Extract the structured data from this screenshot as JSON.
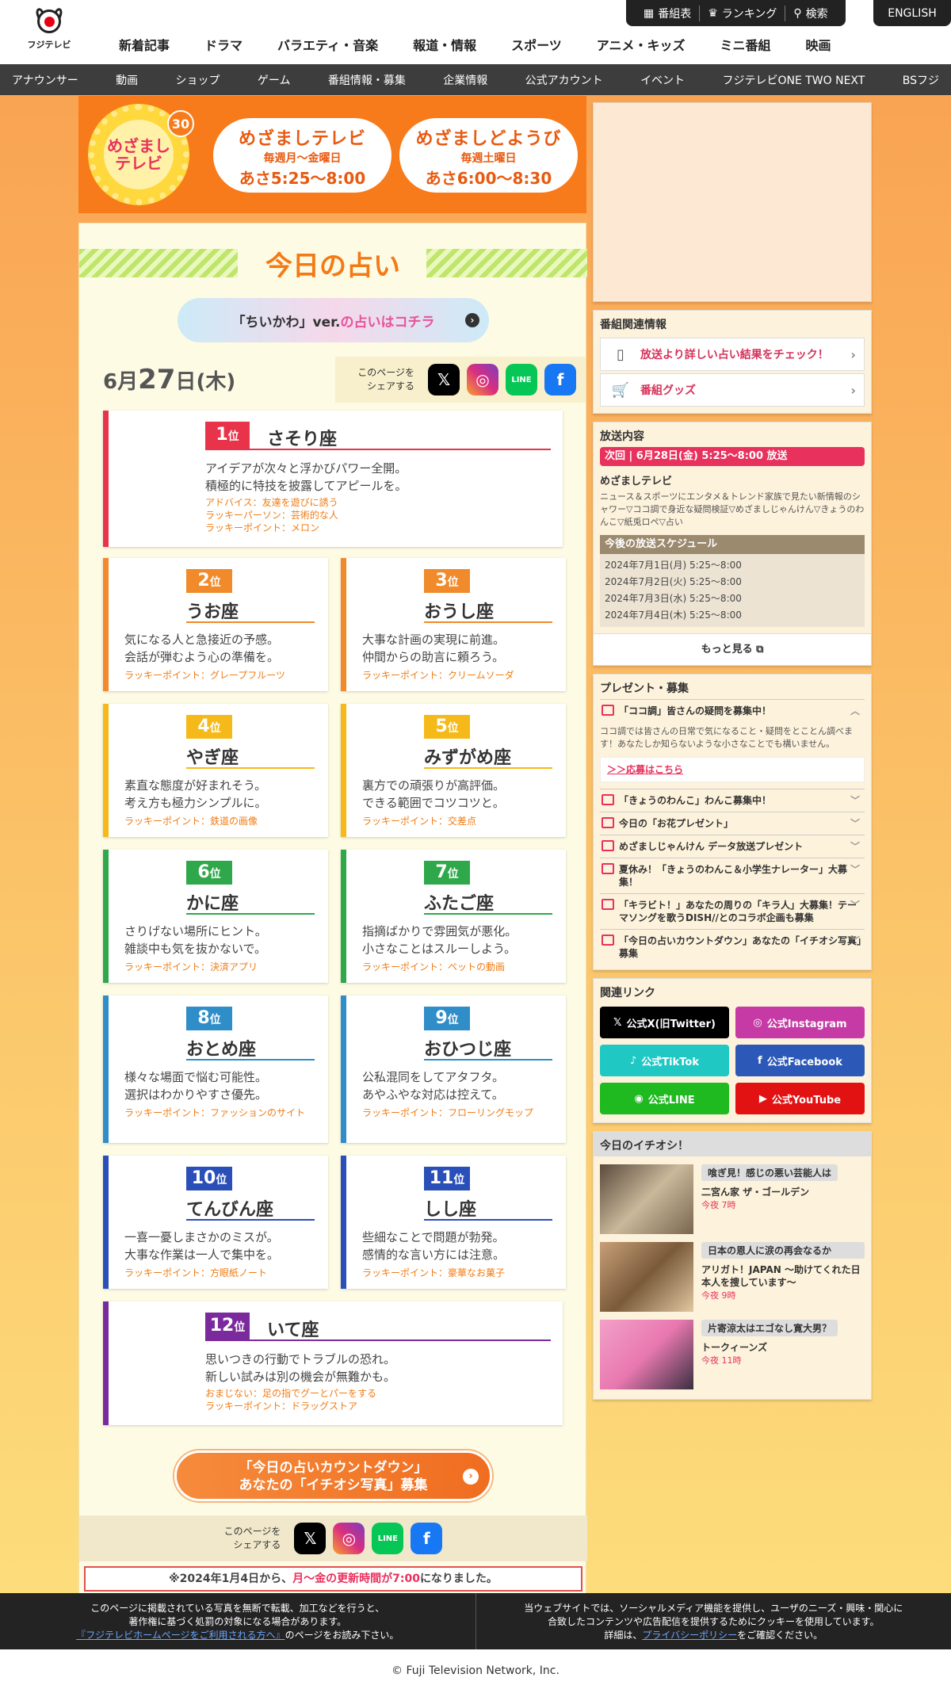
{
  "header": {
    "logo_text": "フジテレビ",
    "nav": [
      "新着記事",
      "ドラマ",
      "バラエティ・音楽",
      "報道・情報",
      "スポーツ",
      "アニメ・キッズ",
      "ミニ番組",
      "映画"
    ],
    "topbar": [
      "番組表",
      "ランキング",
      "検索"
    ],
    "english": "ENGLISH",
    "subnav": [
      "アナウンサー",
      "動画",
      "ショップ",
      "ゲーム",
      "番組情報・募集",
      "企業情報",
      "公式アカウント",
      "イベント",
      "フジテレビONE TWO NEXT",
      "BSフジ"
    ]
  },
  "hero": {
    "logo_text": "めざましテレビ",
    "anniv": "30",
    "shows": [
      {
        "name": "めざましテレビ",
        "days": "毎週月〜金曜日",
        "time": "あさ5:25〜8:00"
      },
      {
        "name": "めざましどようび",
        "days": "毎週土曜日",
        "time": "あさ6:00〜8:30"
      }
    ]
  },
  "uranai": {
    "title": "今日の占い",
    "chiikawa_a": "「ちいかわ」ver.",
    "chiikawa_b": "の占いはコチラ",
    "date_month": "6月",
    "date_day": "27",
    "date_suffix": "日",
    "date_dow": "(木)",
    "share_label1": "このページを",
    "share_label2": "シェアする",
    "rank_suffix": "位",
    "cards": [
      {
        "rank": "1",
        "sign": "さそり座",
        "msg1": "アイデアが次々と浮かびパワー全開。",
        "msg2": "積極的に特技を披露してアピールを。",
        "extra1": "アドバイス：友達を遊びに誘う",
        "extra2": "ラッキーパーソン：芸術的な人",
        "lucky": "ラッキーポイント：メロン"
      },
      {
        "rank": "2",
        "sign": "うお座",
        "msg1": "気になる人と急接近の予感。",
        "msg2": "会話が弾むよう心の準備を。",
        "lucky": "ラッキーポイント：グレープフルーツ"
      },
      {
        "rank": "3",
        "sign": "おうし座",
        "msg1": "大事な計画の実現に前進。",
        "msg2": "仲間からの助言に頼ろう。",
        "lucky": "ラッキーポイント：クリームソーダ"
      },
      {
        "rank": "4",
        "sign": "やぎ座",
        "msg1": "素直な態度が好まれそう。",
        "msg2": "考え方も極力シンプルに。",
        "lucky": "ラッキーポイント：鉄道の画像"
      },
      {
        "rank": "5",
        "sign": "みずがめ座",
        "msg1": "裏方での頑張りが高評価。",
        "msg2": "できる範囲でコツコツと。",
        "lucky": "ラッキーポイント：交差点"
      },
      {
        "rank": "6",
        "sign": "かに座",
        "msg1": "さりげない場所にヒント。",
        "msg2": "雑談中も気を抜かないで。",
        "lucky": "ラッキーポイント：決済アプリ"
      },
      {
        "rank": "7",
        "sign": "ふたご座",
        "msg1": "指摘ばかりで雰囲気が悪化。",
        "msg2": "小さなことはスルーしよう。",
        "lucky": "ラッキーポイント：ペットの動画"
      },
      {
        "rank": "8",
        "sign": "おとめ座",
        "msg1": "様々な場面で悩む可能性。",
        "msg2": "選択はわかりやすさ優先。",
        "lucky": "ラッキーポイント：ファッションのサイト"
      },
      {
        "rank": "9",
        "sign": "おひつじ座",
        "msg1": "公私混同をしてアタフタ。",
        "msg2": "あやふやな対応は控えて。",
        "lucky": "ラッキーポイント：フローリングモップ"
      },
      {
        "rank": "10",
        "sign": "てんびん座",
        "msg1": "一喜一憂しまさかのミスが。",
        "msg2": "大事な作業は一人で集中を。",
        "lucky": "ラッキーポイント：方眼紙ノート"
      },
      {
        "rank": "11",
        "sign": "しし座",
        "msg1": "些細なことで問題が勃発。",
        "msg2": "感情的な言い方には注意。",
        "lucky": "ラッキーポイント：豪華なお菓子"
      },
      {
        "rank": "12",
        "sign": "いて座",
        "msg1": "思いつきの行動でトラブルの恐れ。",
        "msg2": "新しい試みは別の機会が無難かも。",
        "extra1": "おまじない：足の指でグーとパーをする",
        "lucky": "ラッキーポイント：ドラッグストア"
      }
    ],
    "countdown1": "「今日の占いカウントダウン」",
    "countdown2": "あなたの「イチオシ写真」募集",
    "notice_a": "※2024年1月4日から、",
    "notice_b": "月〜金の更新時間が7:00",
    "notice_c": "になりました。"
  },
  "colors": {
    "red": "#e8334a",
    "orange": "#f08a2a",
    "yellow": "#f5b91a",
    "green": "#2fa84b",
    "blue": "#2f8dc8",
    "navy": "#2a4fb8",
    "purple": "#7a2a9c"
  },
  "side": {
    "related_title": "番組関連情報",
    "related": [
      "放送より詳しい占い結果をチェック！",
      "番組グッズ"
    ],
    "broadcast_title": "放送内容",
    "next_onair": "次回 | 6月28日(金) 5:25〜8:00 放送",
    "prog_name": "めざましテレビ",
    "prog_desc": "ニュース＆スポーツにエンタメ＆トレンド家族で見たい新情報のシャワー▽ココ調で身近な疑問検証▽めざましじゃんけん▽きょうのわんこ▽紙兎ロペ▽占い",
    "sched_title": "今後の放送スケジュール",
    "sched": [
      "2024年7月1日(月) 5:25〜8:00",
      "2024年7月2日(火) 5:25〜8:00",
      "2024年7月3日(水) 5:25〜8:00",
      "2024年7月4日(木) 5:25〜8:00"
    ],
    "more": "もっと見る",
    "present_title": "プレゼント・募集",
    "present_open": "「ココ調」皆さんの疑問を募集中！",
    "present_body": "ココ調では皆さんの日常で気になること・疑問をとことん調べます！あなたしか知らないような小さなことでも構いません。",
    "present_link": "＞＞応募はこちら",
    "presents": [
      "「きょうのわんこ」わんこ募集中！",
      "今日の「お花プレゼント」",
      "めざましじゃんけん データ放送プレゼント",
      "夏休み！「きょうのわんこ＆小学生ナレーター」大募集！",
      "「キラビト！」あなたの周りの「キラ人」大募集！テーマソングを歌うDISH//とのコラボ企画も募集",
      "「今日の占いカウントダウン」あなたの「イチオシ写真」募集"
    ],
    "links_title": "関連リンク",
    "links": [
      "公式X(旧Twitter)",
      "公式Instagram",
      "公式TikTok",
      "公式Facebook",
      "公式LINE",
      "公式YouTube"
    ],
    "pick_title": "今日のイチオシ！",
    "picks": [
      {
        "tag": "喰ぎ見！感じの悪い芸能人は",
        "name": "二宮ん家 ザ・ゴールデン",
        "time": "今夜 7時"
      },
      {
        "tag": "日本の恩人に涙の再会なるか",
        "name": "アリガト！JAPAN 〜助けてくれた日本人を捜しています〜",
        "time": "今夜 9時"
      },
      {
        "tag": "片寄涼太はエゴなし寛大男？",
        "name": "トークィーンズ",
        "time": "今夜 11時"
      }
    ]
  },
  "footer": {
    "left1": "このページに掲載されている写真を無断で転載、加工などを行うと、",
    "left2": "著作権に基づく処罰の対象になる場合があります。",
    "left3_link": "『フジテレビホームページをご利用される方へ』",
    "left3_rest": "のページをお読み下さい。",
    "right1": "当ウェブサイトでは、ソーシャルメディア機能を提供し、ユーザのニーズ・興味・関心に",
    "right2": "合致したコンテンツや広告配信を提供するためにクッキーを使用しています。",
    "right3_a": "詳細は、",
    "right3_link": "プライバシーポリシー",
    "right3_b": "をご確認ください。",
    "copyright": "© Fuji Television Network, Inc."
  }
}
